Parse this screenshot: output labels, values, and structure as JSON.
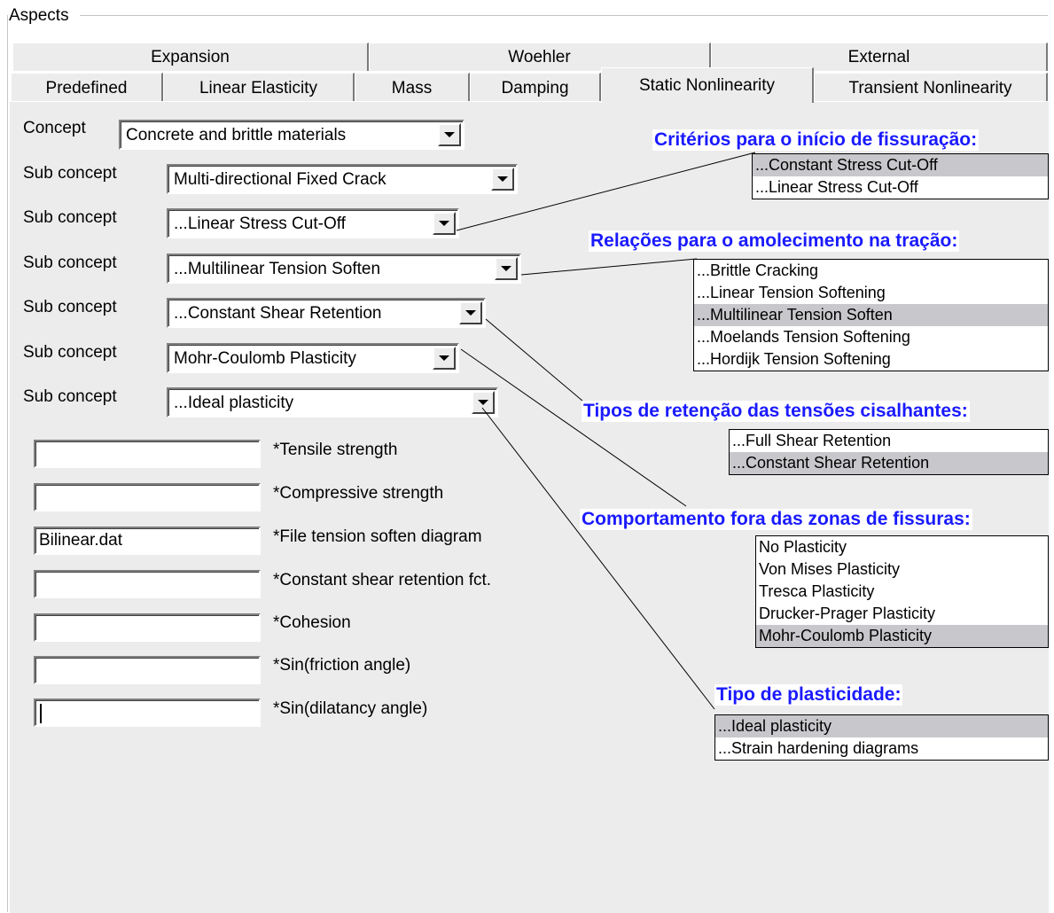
{
  "group_label": "Aspects",
  "tabs_row1": [
    "Expansion",
    "Woehler",
    "External"
  ],
  "tabs_row2": [
    "Predefined",
    "Linear Elasticity",
    "Mass",
    "Damping",
    "Static Nonlinearity",
    "Transient Nonlinearity"
  ],
  "active_tab": "Static Nonlinearity",
  "concept": {
    "label": "Concept",
    "value": "Concrete and brittle materials"
  },
  "sub_concepts": [
    {
      "label": "Sub concept",
      "value": "Multi-directional Fixed Crack"
    },
    {
      "label": "Sub concept",
      "value": "...Linear Stress Cut-Off"
    },
    {
      "label": "Sub concept",
      "value": "...Multilinear Tension Soften"
    },
    {
      "label": "Sub concept",
      "value": "...Constant Shear Retention"
    },
    {
      "label": "Sub concept",
      "value": "Mohr-Coulomb Plasticity"
    },
    {
      "label": "Sub concept",
      "value": "...Ideal plasticity"
    }
  ],
  "params": [
    {
      "label": "*Tensile strength",
      "value": ""
    },
    {
      "label": "*Compressive strength",
      "value": ""
    },
    {
      "label": "*File tension soften diagram",
      "value": "Bilinear.dat"
    },
    {
      "label": "*Constant shear retention fct.",
      "value": ""
    },
    {
      "label": "*Cohesion",
      "value": ""
    },
    {
      "label": "*Sin(friction angle)",
      "value": ""
    },
    {
      "label": "*Sin(dilatancy angle)",
      "value": ""
    }
  ],
  "annotations": [
    {
      "title": "Critérios para o início de fissuração:",
      "options": [
        "...Constant Stress Cut-Off",
        "...Linear Stress Cut-Off"
      ],
      "selected": 0
    },
    {
      "title": "Relações para o amolecimento na tração:",
      "options": [
        "...Brittle Cracking",
        "...Linear Tension Softening",
        "...Multilinear Tension Soften",
        "...Moelands Tension Softening",
        "...Hordijk Tension Softening"
      ],
      "selected": 2
    },
    {
      "title": "Tipos de retenção das tensões cisalhantes:",
      "options": [
        "...Full Shear Retention",
        "...Constant Shear Retention"
      ],
      "selected": 1
    },
    {
      "title": "Comportamento fora das zonas de fissuras:",
      "options": [
        "No Plasticity",
        "Von Mises Plasticity",
        "Tresca Plasticity",
        "Drucker-Prager Plasticity",
        "Mohr-Coulomb Plasticity"
      ],
      "selected": 4
    },
    {
      "title": "Tipo de plasticidade:",
      "options": [
        "...Ideal plasticity",
        "...Strain hardening diagrams"
      ],
      "selected": 0
    }
  ],
  "colors": {
    "annotation_title": "#1a1aff",
    "selected_option": "#c8c8cc",
    "panel": "#ececec"
  }
}
